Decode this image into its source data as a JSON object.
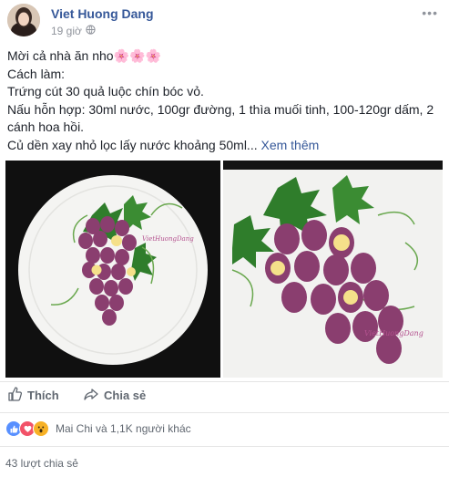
{
  "post": {
    "author": "Viet Huong Dang",
    "time": "19 giờ",
    "more_label": "•••",
    "lines": [
      "Mời cả nhà ăn nho🌸🌸🌸",
      "Cách làm:",
      "Trứng cút 30 quả luộc chín bóc vỏ.",
      "Nấu hỗn hợp: 30ml nước, 100gr đường, 1 thìa muối tinh, 100-120gr dấm, 2 cánh hoa hồi."
    ],
    "last_line": "Củ dền xay nhỏ lọc lấy nước khoảng 50ml...",
    "see_more": "Xem thêm",
    "watermark": "VietHuongDang"
  },
  "actions": {
    "like": "Thích",
    "share": "Chia sẻ"
  },
  "reactions": {
    "summary": "Mai Chi và 1,1K người khác",
    "icons": [
      "like-reaction-icon",
      "love-reaction-icon",
      "wow-reaction-icon"
    ]
  },
  "shares": "43 lượt chia sẻ",
  "colors": {
    "link": "#365899",
    "text": "#1d2129",
    "muted": "#90949c",
    "like": "#5890ff",
    "love": "#f25268",
    "wow": "#f7b125",
    "grape": "#8a3e6f"
  }
}
